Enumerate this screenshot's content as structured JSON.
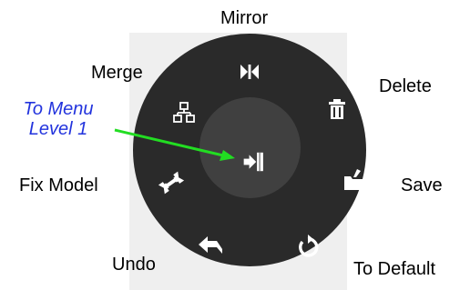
{
  "menu": {
    "items": {
      "mirror": {
        "label": "Mirror",
        "icon": "mirror-icon"
      },
      "delete": {
        "label": "Delete",
        "icon": "trash-icon"
      },
      "save": {
        "label": "Save",
        "icon": "folder-save-icon"
      },
      "to_default": {
        "label": "To Default",
        "icon": "reset-rotate-icon"
      },
      "undo": {
        "label": "Undo",
        "icon": "undo-arrow-icon"
      },
      "fix_model": {
        "label": "Fix Model",
        "icon": "wrench-icon"
      },
      "merge": {
        "label": "Merge",
        "icon": "merge-blocks-icon"
      }
    },
    "center": {
      "icon": "exit-to-menu-icon"
    }
  },
  "annotation": {
    "line1": "To Menu",
    "line2": "Level 1"
  },
  "colors": {
    "ring": "#2a2a2a",
    "hub": "#404040",
    "icon": "#ffffff",
    "callout_text": "#2233dd",
    "callout_arrow": "#22dd22"
  }
}
